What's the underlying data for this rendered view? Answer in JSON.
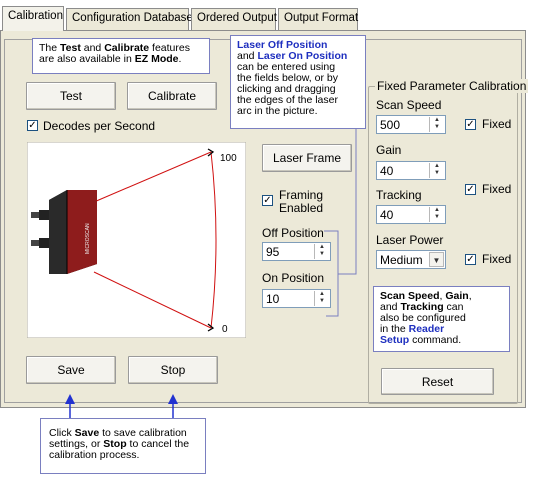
{
  "tabs": [
    {
      "label": "Calibration",
      "active": true
    },
    {
      "label": "Configuration Database",
      "active": false
    },
    {
      "label": "Ordered Output",
      "active": false
    },
    {
      "label": "Output Format",
      "active": false
    }
  ],
  "callouts": {
    "top_left": {
      "line1_pre": "The ",
      "test": "Test",
      "line1_mid": " and ",
      "cal": "Calibrate",
      "line1_post": " features",
      "line2_pre": "are also available in ",
      "ez": "EZ Mode",
      "line2_post": "."
    },
    "laser": {
      "laser_off": "Laser Off Position",
      "and": "and ",
      "laser_on": "Laser On Position",
      "body": [
        "can be entered using",
        "the fields below, or by",
        "clicking and dragging",
        "the edges of the laser",
        "arc in the picture."
      ]
    },
    "reader": {
      "scan": "Scan Speed",
      "comma1": ", ",
      "gain": "Gain",
      "comma2": ",",
      "and": "and ",
      "tracking": "Tracking",
      "rest1": " can",
      "rest2": "also be configured",
      "in_the": "in the ",
      "reader": "Reader",
      "setup": "Setup",
      "command": " command."
    },
    "bottom": {
      "pre1": "Click ",
      "save": "Save",
      "mid1": " to save calibration",
      "pre2": "settings, or ",
      "stop": "Stop",
      "mid2": " to cancel the",
      "line3": "calibration process."
    }
  },
  "buttons": {
    "test": "Test",
    "calibrate": "Calibrate",
    "laser_frame": "Laser Frame",
    "save": "Save",
    "stop": "Stop",
    "reset": "Reset"
  },
  "decodes": {
    "label": "Decodes per Second",
    "checked": true
  },
  "laser_picture": {
    "top_label": "100",
    "bottom_label": "0",
    "device_brand": "MICROSCAN"
  },
  "framing": {
    "label_line1": "Framing",
    "label_line2": "Enabled",
    "checked": true
  },
  "positions": {
    "off_label": "Off Position",
    "off_value": "95",
    "on_label": "On Position",
    "on_value": "10"
  },
  "fixed_calibration": {
    "title": "Fixed Parameter Calibration",
    "scan_speed": {
      "label": "Scan Speed",
      "value": "500",
      "fixed_label": "Fixed",
      "fixed": true
    },
    "gain": {
      "label": "Gain",
      "value": "40"
    },
    "tracking": {
      "label": "Tracking",
      "value": "40",
      "fixed_label": "Fixed",
      "fixed": true
    },
    "laser_power": {
      "label": "Laser Power",
      "value": "Medium",
      "fixed_label": "Fixed",
      "fixed": true
    }
  },
  "colors": {
    "panel": "#ece9d8",
    "callout_border": "#7a7fc0",
    "accent_blue": "#1e2fbf",
    "laser_red": "#d01010"
  }
}
